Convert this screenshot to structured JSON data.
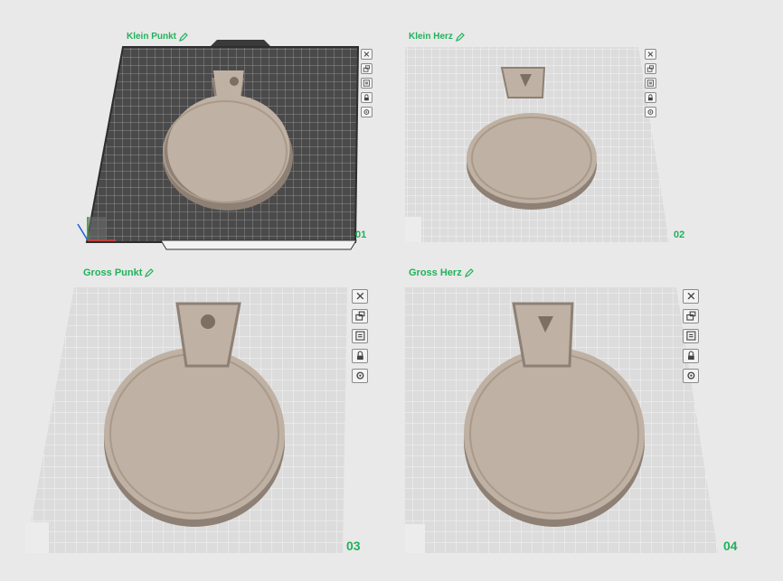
{
  "plates": [
    {
      "name": "Klein Punkt",
      "number": "01",
      "style": "dark",
      "cutout": "dot"
    },
    {
      "name": "Klein Herz",
      "number": "02",
      "style": "light",
      "cutout": "heart"
    },
    {
      "name": "Gross Punkt",
      "number": "03",
      "style": "light",
      "cutout": "dot"
    },
    {
      "name": "Gross Herz",
      "number": "04",
      "style": "light",
      "cutout": "heart"
    }
  ],
  "toolbar_icons": [
    "close-icon",
    "arrange-icon",
    "plate-settings-icon",
    "lock-icon",
    "gear-icon"
  ],
  "colors": {
    "accent": "#1fb25a",
    "plate_dark": "#4a4a4a",
    "plate_light": "#d6d6d6",
    "model": "#bfb1a3",
    "background": "#e9e9e9"
  }
}
